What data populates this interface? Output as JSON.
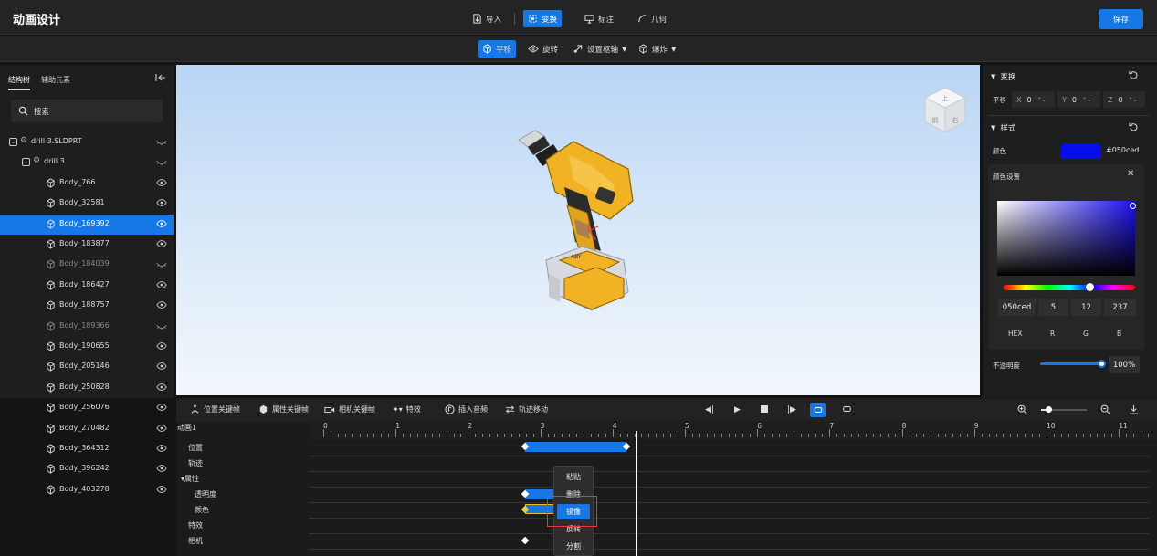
{
  "app": {
    "title": "动画设计",
    "save_label": "保存"
  },
  "topbar": {
    "items": [
      {
        "label": "导入",
        "icon": "import-icon",
        "active": false
      },
      {
        "label": "变换",
        "icon": "transform-icon",
        "active": true
      },
      {
        "label": "标注",
        "icon": "annotate-icon",
        "active": false
      },
      {
        "label": "几何",
        "icon": "geometry-icon",
        "active": false
      }
    ]
  },
  "subbar": {
    "items": [
      {
        "label": "平移",
        "icon": "move-icon",
        "active": true
      },
      {
        "label": "旋转",
        "icon": "rotate-icon",
        "active": false
      },
      {
        "label": "设置枢轴",
        "icon": "pivot-icon",
        "active": false,
        "dropdown": true
      },
      {
        "label": "爆炸",
        "icon": "explode-icon",
        "active": false,
        "dropdown": true
      }
    ]
  },
  "left": {
    "tabs": [
      "结构树",
      "辅助元素"
    ],
    "search_placeholder": "搜索",
    "tree": [
      {
        "label": "drill 3.SLDPRT",
        "level": 0,
        "type": "assembly",
        "visible": false
      },
      {
        "label": "drill 3",
        "level": 1,
        "type": "assembly",
        "visible": false
      },
      {
        "label": "Body_766",
        "level": 2,
        "visible": true
      },
      {
        "label": "Body_32581",
        "level": 2,
        "visible": true
      },
      {
        "label": "Body_169392",
        "level": 2,
        "visible": true,
        "selected": true
      },
      {
        "label": "Body_183877",
        "level": 2,
        "visible": true
      },
      {
        "label": "Body_184039",
        "level": 2,
        "visible": false,
        "dim": true
      },
      {
        "label": "Body_186427",
        "level": 2,
        "visible": true
      },
      {
        "label": "Body_188757",
        "level": 2,
        "visible": true
      },
      {
        "label": "Body_189366",
        "level": 2,
        "visible": false,
        "dim": true
      },
      {
        "label": "Body_190655",
        "level": 2,
        "visible": true
      },
      {
        "label": "Body_205146",
        "level": 2,
        "visible": true
      },
      {
        "label": "Body_250828",
        "level": 2,
        "visible": true
      },
      {
        "label": "Body_256076",
        "level": 2,
        "visible": true
      },
      {
        "label": "Body_270482",
        "level": 2,
        "visible": true
      },
      {
        "label": "Body_364312",
        "level": 2,
        "visible": true
      },
      {
        "label": "Body_396242",
        "level": 2,
        "visible": true
      },
      {
        "label": "Body_403278",
        "level": 2,
        "visible": true
      }
    ]
  },
  "viewcube": {
    "front": "前",
    "right": "右",
    "top": "上"
  },
  "right": {
    "transform": {
      "title": "变换",
      "move_label": "平移",
      "x_label": "X",
      "x": "0",
      "y_label": "Y",
      "y": "0",
      "z_label": "Z",
      "z": "0"
    },
    "style": {
      "title": "样式",
      "color_label": "颜色",
      "color_value": "#050ced"
    },
    "color_settings": {
      "title": "颜色设置",
      "hex": "050ced",
      "r": "5",
      "g": "12",
      "b": "237",
      "hex_label": "HEX",
      "r_label": "R",
      "g_label": "G",
      "b_label": "B"
    },
    "opacity": {
      "label": "不透明度",
      "value": "100%"
    }
  },
  "timeline": {
    "toolbar": [
      "位置关键帧",
      "属性关键帧",
      "相机关键帧",
      "特效",
      "插入音频",
      "轨迹移动"
    ],
    "animation_name": "动画1",
    "ticks": [
      "0",
      "1",
      "2",
      "3",
      "4",
      "5",
      "6",
      "7",
      "8",
      "9",
      "10",
      "11"
    ],
    "tracks": [
      "位置",
      "轨迹",
      "▾属性",
      "透明度",
      "颜色",
      "特效",
      "相机"
    ],
    "context_menu": [
      "粘贴",
      "删除",
      "镜像",
      "反转",
      "分割"
    ],
    "highlighted_menu_item": "镜像"
  },
  "colors": {
    "accent": "#1677e6",
    "selection": "#050ced",
    "highlight_box": "#e53935"
  }
}
